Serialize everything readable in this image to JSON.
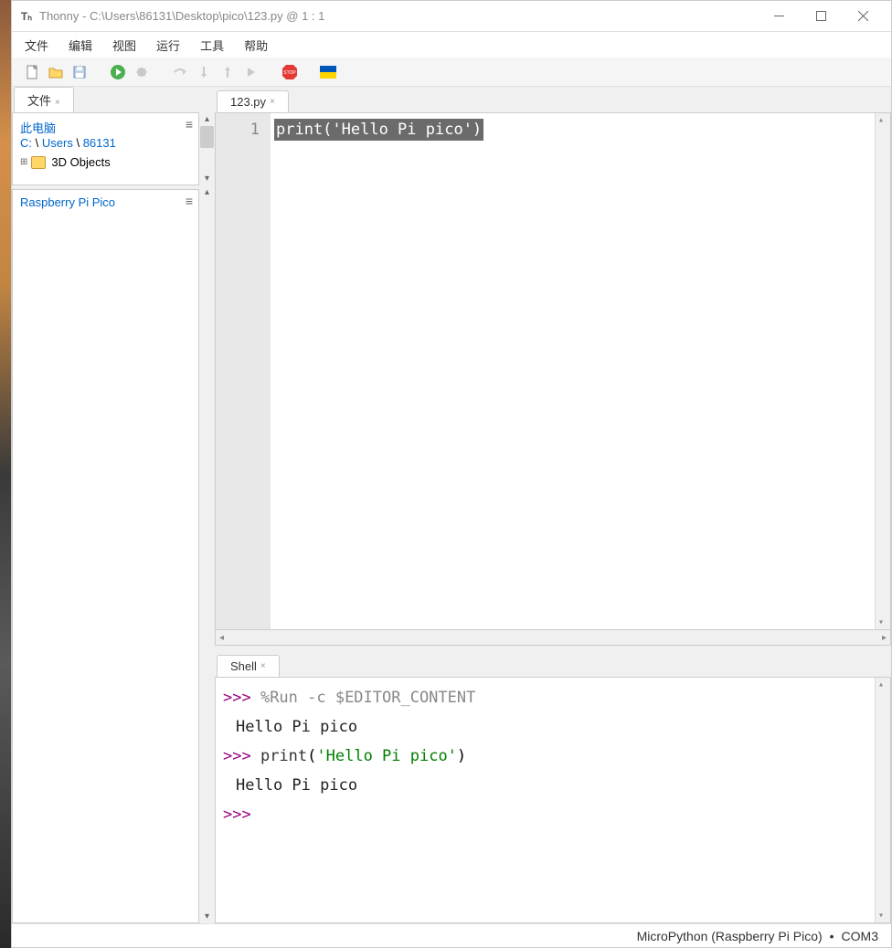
{
  "window": {
    "app_name": "Thonny",
    "title_sep": "  -  ",
    "path": "C:\\Users\\86131\\Desktop\\pico\\123.py",
    "cursor_at": "  @  1 : 1"
  },
  "menu": {
    "file": "文件",
    "edit": "编辑",
    "view": "视图",
    "run": "运行",
    "tools": "工具",
    "help": "帮助"
  },
  "toolbar": {
    "new": "new-file",
    "open": "open-file",
    "save": "save-file",
    "run": "run-script",
    "debug": "debug",
    "step_over": "step-over",
    "step_into": "step-into",
    "step_out": "step-out",
    "resume": "resume",
    "stop": "stop"
  },
  "sidebar": {
    "tab_label": "文件",
    "this_pc": "此电脑",
    "path_drive": "C: ",
    "path_sep": "\\",
    "path_users": "Users",
    "path_user": "86131",
    "folder1": "3D Objects",
    "device": "Raspberry Pi Pico"
  },
  "editor": {
    "tab_name": "123.py",
    "line_number_1": "1",
    "code_line_1": "print('Hello Pi pico')"
  },
  "shell": {
    "tab_label": "Shell",
    "prompt": ">>> ",
    "run_cmd": "%Run -c $EDITOR_CONTENT",
    "output1": "Hello Pi pico",
    "call_func": "print",
    "call_paren_open": "(",
    "call_str": "'Hello Pi pico'",
    "call_paren_close": ")",
    "output2": "Hello Pi pico"
  },
  "status": {
    "interpreter": "MicroPython (Raspberry Pi Pico)",
    "sep": "•",
    "port": "COM3"
  }
}
